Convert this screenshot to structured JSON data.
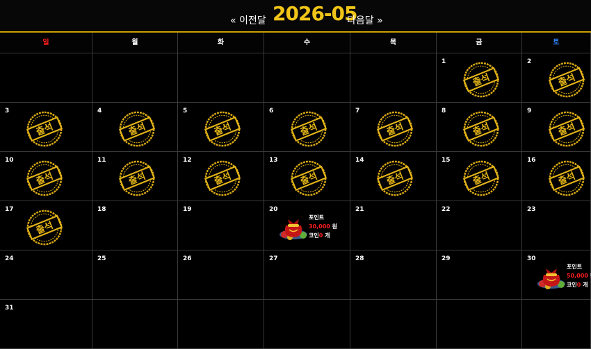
{
  "header": {
    "prev_label": "« 이전달",
    "month": "2026-05",
    "next_label": "다음달 »"
  },
  "colors": {
    "accent": "#f0c418",
    "sunday": "#ff1d1d",
    "saturday": "#2f86ff",
    "grid_line": "#3a3a3a"
  },
  "weekdays": [
    {
      "label": "일",
      "color": "#ff1d1d"
    },
    {
      "label": "월",
      "color": "#ffffff"
    },
    {
      "label": "화",
      "color": "#ffffff"
    },
    {
      "label": "수",
      "color": "#ffffff"
    },
    {
      "label": "목",
      "color": "#ffffff"
    },
    {
      "label": "금",
      "color": "#ffffff"
    },
    {
      "label": "토",
      "color": "#2f86ff"
    }
  ],
  "stamp_label": "출석",
  "weeks": [
    [
      {
        "day": ""
      },
      {
        "day": ""
      },
      {
        "day": ""
      },
      {
        "day": ""
      },
      {
        "day": ""
      },
      {
        "day": "1",
        "attended": true
      },
      {
        "day": "2",
        "attended": true
      }
    ],
    [
      {
        "day": "3",
        "attended": true
      },
      {
        "day": "4",
        "attended": true
      },
      {
        "day": "5",
        "attended": true
      },
      {
        "day": "6",
        "attended": true
      },
      {
        "day": "7",
        "attended": true
      },
      {
        "day": "8",
        "attended": true
      },
      {
        "day": "9",
        "attended": true
      }
    ],
    [
      {
        "day": "10",
        "attended": true
      },
      {
        "day": "11",
        "attended": true
      },
      {
        "day": "12",
        "attended": true
      },
      {
        "day": "13",
        "attended": true
      },
      {
        "day": "14",
        "attended": true
      },
      {
        "day": "15",
        "attended": true
      },
      {
        "day": "16",
        "attended": true
      }
    ],
    [
      {
        "day": "17",
        "attended": true
      },
      {
        "day": "18"
      },
      {
        "day": "19"
      },
      {
        "day": "20",
        "reward": {
          "title": "포인트",
          "amount": "30,000",
          "unit": "원",
          "coin_label": "코인",
          "coin_count": "0",
          "coin_unit": "개"
        }
      },
      {
        "day": "21"
      },
      {
        "day": "22"
      },
      {
        "day": "23"
      }
    ],
    [
      {
        "day": "24"
      },
      {
        "day": "25"
      },
      {
        "day": "26"
      },
      {
        "day": "27"
      },
      {
        "day": "28"
      },
      {
        "day": "29"
      },
      {
        "day": "30",
        "reward": {
          "title": "포인트",
          "amount": "50,000",
          "unit": "원",
          "coin_label": "코인",
          "coin_count": "0",
          "coin_unit": "개"
        }
      }
    ],
    [
      {
        "day": "31"
      },
      {
        "day": ""
      },
      {
        "day": ""
      },
      {
        "day": ""
      },
      {
        "day": ""
      },
      {
        "day": ""
      },
      {
        "day": ""
      }
    ]
  ]
}
